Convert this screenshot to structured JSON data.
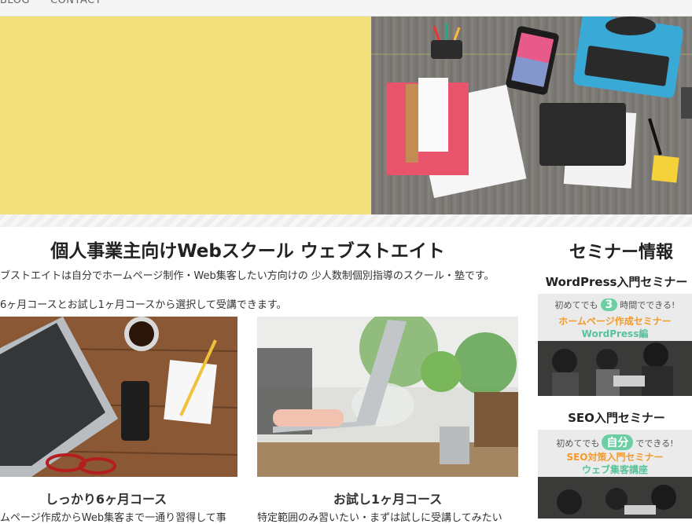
{
  "nav": {
    "items": [
      "BLOG",
      "CONTACT"
    ]
  },
  "main": {
    "title": "個人事業主向けWebスクール ウェブストエイト",
    "intro1": "ブストエイトは自分でホームページ制作・Web集客したい方向けの 少人数制個別指導のスクール・塾です。",
    "intro2": "6ヶ月コースとお試し1ヶ月コースから選択して受講できます。",
    "courses": [
      {
        "title": "しっかり6ヶ月コース",
        "desc": "ムページ作成からWeb集客まで一通り習得して事"
      },
      {
        "title": "お試し1ヶ月コース",
        "desc": "特定範囲のみ習いたい・まずは試しに受講してみたい"
      }
    ]
  },
  "sidebar": {
    "title": "セミナー情報",
    "seminars": [
      {
        "label": "WordPress入門セミナー",
        "line1_pre": "初めてでも",
        "line1_num": "3",
        "line1_post": "時間でできる!",
        "line2": "ホームページ作成セミナー",
        "line3": "WordPress編"
      },
      {
        "label": "SEO入門セミナー",
        "line1_pre": "初めてでも",
        "line1_num": "自分",
        "line1_post": "でできる!",
        "line2": "SEO対策入門セミナー",
        "line3": "ウェブ集客講座"
      }
    ]
  },
  "colors": {
    "hero_yellow": "#f3e07a",
    "accent_green": "#6ccfa3",
    "accent_orange": "#f39a2a"
  }
}
